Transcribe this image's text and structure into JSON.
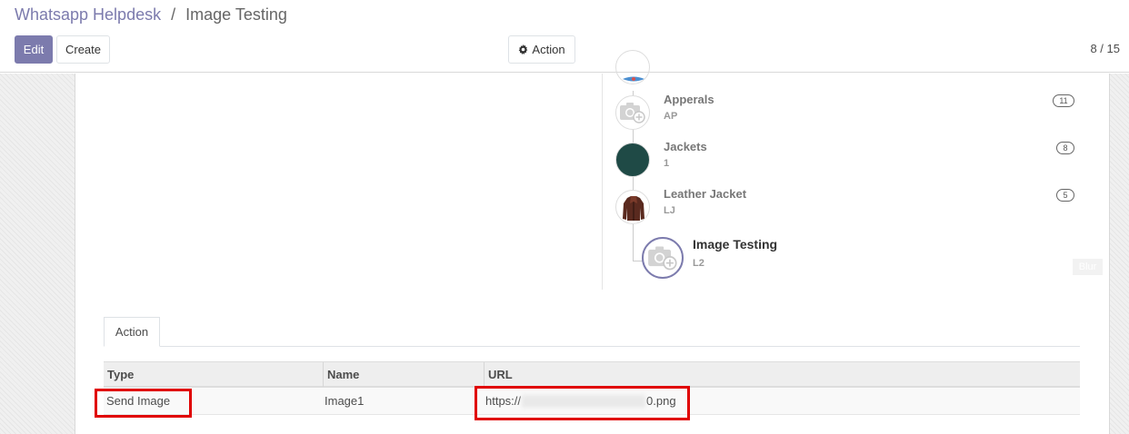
{
  "breadcrumb": {
    "root": "Whatsapp Helpdesk",
    "separator": "/",
    "current": "Image Testing"
  },
  "toolbar": {
    "edit_label": "Edit",
    "create_label": "Create",
    "action_label": "Action",
    "action_icon": "gear-icon"
  },
  "pager": {
    "text": "8 / 15"
  },
  "hierarchy": {
    "items": [
      {
        "name": "Apperals",
        "code": "AP",
        "count": "11",
        "avatar": "camera-placeholder-icon"
      },
      {
        "name": "Jackets",
        "code": "1",
        "count": "8",
        "avatar": "teal-circle-image"
      },
      {
        "name": "Leather Jacket",
        "code": "LJ",
        "count": "5",
        "avatar": "leather-jacket-image"
      }
    ],
    "current": {
      "name": "Image Testing",
      "code": "L2",
      "avatar": "camera-placeholder-icon"
    },
    "tag": "Blur"
  },
  "tabs": [
    {
      "label": "Action"
    }
  ],
  "table": {
    "columns": [
      "Type",
      "Name",
      "URL"
    ],
    "rows": [
      {
        "type": "Send Image",
        "name": "Image1",
        "url_prefix": "https://",
        "url_suffix": "0.png"
      }
    ]
  },
  "colors": {
    "brand": "#7c7bad",
    "highlight": "#e00000"
  }
}
